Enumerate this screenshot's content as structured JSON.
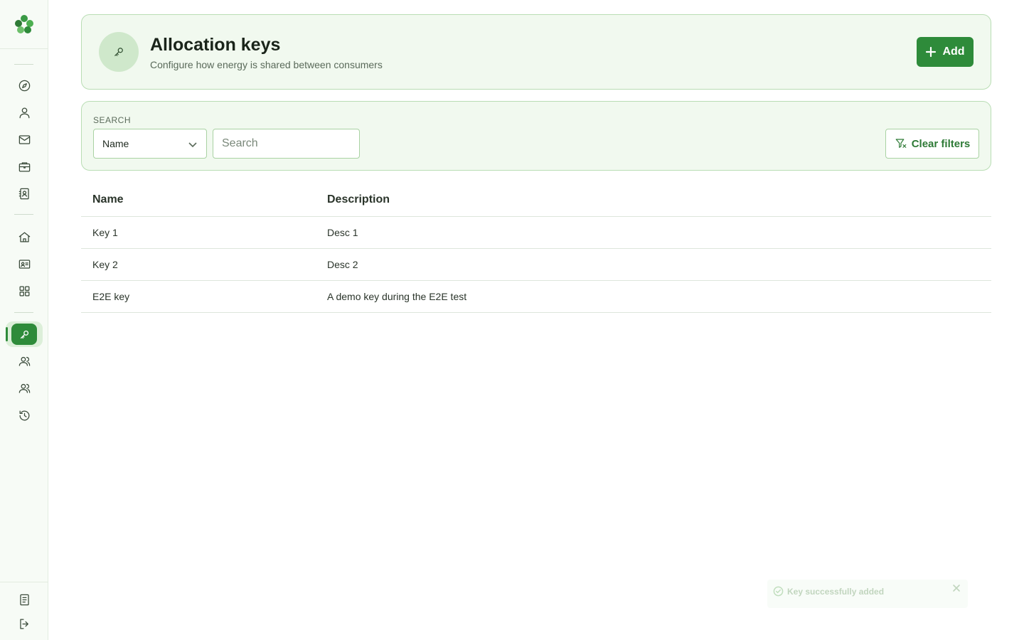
{
  "sidebar": {
    "logo": "clover-logo",
    "nav_top": [
      {
        "icon": "compass-icon"
      },
      {
        "icon": "user-icon"
      },
      {
        "icon": "mail-icon"
      },
      {
        "icon": "briefcase-icon"
      },
      {
        "icon": "contacts-icon"
      }
    ],
    "nav_middle": [
      {
        "icon": "home-icon"
      },
      {
        "icon": "id-card-icon"
      },
      {
        "icon": "grid-icon"
      }
    ],
    "nav_bottom": [
      {
        "icon": "key-icon",
        "active": true
      },
      {
        "icon": "users-icon"
      },
      {
        "icon": "users-alt-icon"
      },
      {
        "icon": "history-icon"
      }
    ],
    "footer": [
      {
        "icon": "document-icon"
      },
      {
        "icon": "logout-icon"
      }
    ]
  },
  "header": {
    "icon": "key-icon",
    "title": "Allocation keys",
    "subtitle": "Configure how energy is shared between consumers",
    "add_label": "Add"
  },
  "search": {
    "label": "SEARCH",
    "field_select": "Name",
    "placeholder": "Search",
    "value": "",
    "clear_label": "Clear filters"
  },
  "table": {
    "columns": [
      "Name",
      "Description"
    ],
    "rows": [
      {
        "name": "Key 1",
        "description": "Desc 1"
      },
      {
        "name": "Key 2",
        "description": "Desc 2"
      },
      {
        "name": "E2E key",
        "description": "A demo key during the E2E test"
      }
    ]
  },
  "toast": {
    "message": "Key successfully added"
  },
  "colors": {
    "accent": "#2e8b3a",
    "card_bg": "#f1f9ef",
    "card_border": "#b9ddb4"
  }
}
